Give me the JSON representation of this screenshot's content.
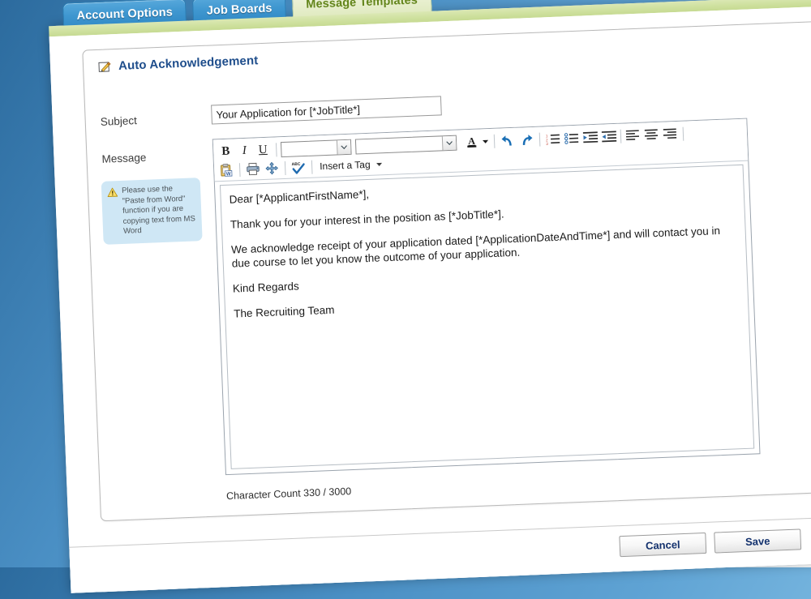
{
  "tabs": [
    {
      "label": "Account Options",
      "active": false
    },
    {
      "label": "Job Boards",
      "active": false
    },
    {
      "label": "Message Templates",
      "active": true
    }
  ],
  "card": {
    "title": "Auto Acknowledgement",
    "title_icon": "edit-note-icon"
  },
  "form": {
    "subject_label": "Subject",
    "subject_value": "Your Application for [*JobTitle*]",
    "subject_placeholder": "",
    "message_label": "Message",
    "note_icon": "warning-triangle-icon",
    "note_text": "Please use the \"Paste from Word\" function if you are copying text from MS Word"
  },
  "toolbar": {
    "bold": "B",
    "italic": "I",
    "underline": "U",
    "font_family_value": "",
    "font_size_value": "",
    "font_color": "A",
    "icons_row1": [
      "bold-icon",
      "italic-icon",
      "underline-icon",
      "font-family-select",
      "font-size-select",
      "font-color-icon",
      "font-color-dropdown-icon",
      "undo-icon",
      "redo-icon",
      "numbered-list-icon",
      "bulleted-list-icon",
      "increase-indent-icon",
      "decrease-indent-icon",
      "align-left-icon",
      "align-center-icon",
      "align-right-icon"
    ],
    "icons_row2": [
      "paste-from-word-icon",
      "print-icon",
      "move-icon",
      "spellcheck-icon"
    ],
    "insert_tag_label": "Insert a Tag",
    "insert_tag_caret": "caret-down-icon"
  },
  "message_body": [
    "Dear [*ApplicantFirstName*],",
    "Thank you for your interest in the position as [*JobTitle*].",
    "We acknowledge receipt of your application dated [*ApplicationDateAndTime*] and will contact you in due course to let you know the outcome of your application.",
    "Kind Regards",
    "The Recruiting Team"
  ],
  "footer": {
    "character_count": "Character Count 330 / 3000",
    "cancel_label": "Cancel",
    "save_label": "Save"
  },
  "colors": {
    "accent_blue": "#2f88c4",
    "active_tab_green": "#dde8bb",
    "active_tab_text": "#63851b",
    "title_blue": "#1f4e8c",
    "note_bg": "#cfe7f5",
    "button_text": "#14326e"
  }
}
